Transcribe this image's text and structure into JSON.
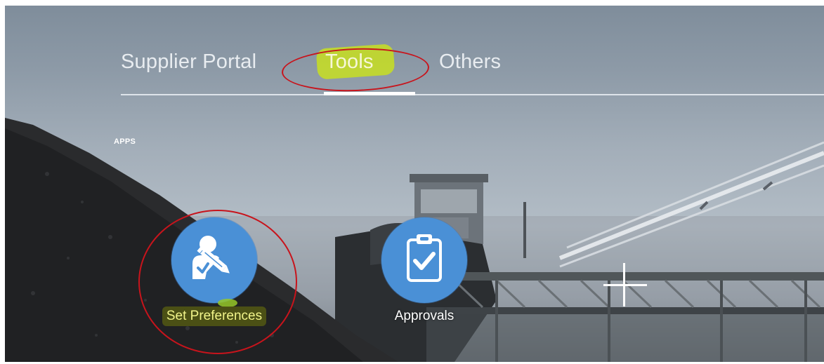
{
  "tabs": [
    {
      "label": "Supplier Portal",
      "active": false
    },
    {
      "label": "Tools",
      "active": true,
      "highlighted": true
    },
    {
      "label": "Others",
      "active": false
    }
  ],
  "section": {
    "label": "APPS"
  },
  "apps": [
    {
      "label": "Set Preferences",
      "icon": "user-edit-icon",
      "highlighted": true
    },
    {
      "label": "Approvals",
      "icon": "clipboard-check-icon",
      "highlighted": false
    }
  ],
  "colors": {
    "app_circle": "#4a90d6",
    "annotation_red": "#c8141c",
    "highlighter_yellow": "#cde614",
    "tab_text": "#e8ecf0"
  }
}
